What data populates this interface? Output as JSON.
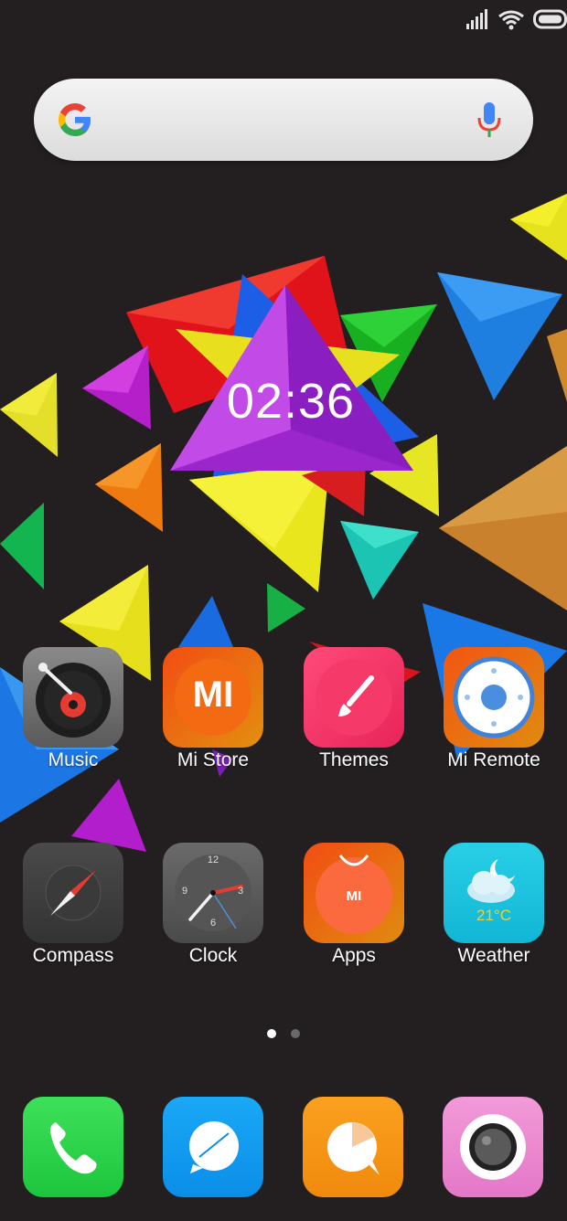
{
  "status_bar": {
    "signal_icon": "cellular-signal-icon",
    "wifi_icon": "wifi-icon",
    "battery_icon": "battery-icon"
  },
  "search_bar": {
    "logo_icon": "google-logo-icon",
    "mic_icon": "microphone-icon"
  },
  "clock_widget": {
    "time": "02:36"
  },
  "apps": [
    {
      "label": "Music",
      "icon": "music-icon"
    },
    {
      "label": "Mi Store",
      "icon": "mi-store-icon",
      "logo_text": "MI"
    },
    {
      "label": "Themes",
      "icon": "themes-brush-icon"
    },
    {
      "label": "Mi Remote",
      "icon": "mi-remote-icon"
    },
    {
      "label": "Compass",
      "icon": "compass-icon"
    },
    {
      "label": "Clock",
      "icon": "clock-icon",
      "dial_numbers": [
        "12",
        "3",
        "6",
        "9"
      ]
    },
    {
      "label": "Apps",
      "icon": "apps-store-icon",
      "logo_text": "MI"
    },
    {
      "label": "Weather",
      "icon": "weather-icon",
      "temperature": "21°C"
    }
  ],
  "page_indicator": {
    "pages": 2,
    "active": 1
  },
  "dock": [
    {
      "icon": "phone-icon"
    },
    {
      "icon": "messaging-icon"
    },
    {
      "icon": "browser-icon"
    },
    {
      "icon": "camera-icon"
    }
  ],
  "colors": {
    "background": "#231f20",
    "text": "#ffffff"
  }
}
